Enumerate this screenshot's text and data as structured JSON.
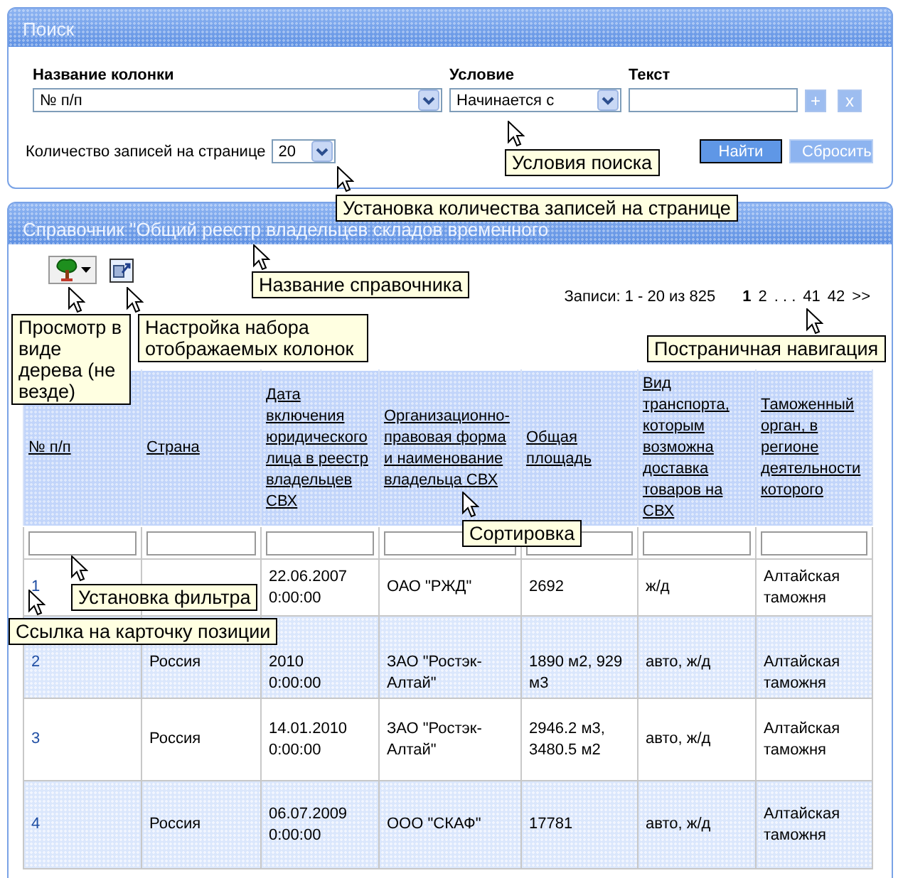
{
  "search": {
    "title": "Поиск",
    "column_label": "Название колонки",
    "column_value": "№ п/п",
    "condition_label": "Условие",
    "condition_value": "Начинается с",
    "text_label": "Текст",
    "add_button": "+",
    "remove_button": "x",
    "page_size_label": "Количество записей на странице",
    "page_size_value": "20",
    "find_button": "Найти",
    "reset_button": "Сбросить"
  },
  "directory": {
    "title": "Справочник \"Общий реестр владельцев складов временного",
    "records_info": "Записи: 1 - 20 из 825",
    "pagination": [
      {
        "label": "1",
        "selected": true
      },
      {
        "label": "2",
        "selected": false
      },
      {
        "label": ". . .",
        "selected": false
      },
      {
        "label": "41",
        "selected": false
      },
      {
        "label": "42",
        "selected": false
      },
      {
        "label": ">>",
        "selected": false
      }
    ],
    "table": {
      "columns": [
        "№ п/п",
        "Страна",
        "Дата включения юридического лица в реестр владельцев СВХ",
        "Организационно-правовая форма и наименование владельца СВХ",
        "Общая площадь",
        "Вид транспорта, которым возможна доставка товаров на СВХ",
        "Таможенный орган, в регионе деятельности которого"
      ],
      "rows": [
        {
          "number": "1",
          "date": "22.06.2007\n0:00:00",
          "owner": "ОАО \"РЖД\"",
          "area": "2692",
          "transport": "ж/д",
          "customs": "Алтайская таможня"
        },
        {
          "number": "2",
          "country": "Россия",
          "date": "2010\n0:00:00",
          "owner": "ЗАО \"Ростэк-Алтай\"",
          "area": "1890 м2, 929 м3",
          "transport": "авто, ж/д",
          "customs": "Алтайская таможня"
        },
        {
          "number": "3",
          "country": "Россия",
          "date": "14.01.2010\n0:00:00",
          "owner": "ЗАО \"Ростэк-Алтай\"",
          "area": "2946.2 м3, 3480.5 м2",
          "transport": "авто, ж/д",
          "customs": "Алтайская таможня"
        },
        {
          "number": "4",
          "country": "Россия",
          "date": "06.07.2009\n0:00:00",
          "owner": "ООО \"СКАФ\"",
          "area": "17781",
          "transport": "авто, ж/д",
          "customs": "Алтайская таможня"
        }
      ]
    }
  },
  "callouts": [
    {
      "text": "Условия поиска"
    },
    {
      "text": "Установка количества записей на странице"
    },
    {
      "text": "Название справочника"
    },
    {
      "text": "Просмотр в виде дерева (не везде)"
    },
    {
      "text": "Настройка набора отображаемых колонок"
    },
    {
      "text": "Постраничная навигация"
    },
    {
      "text": "Сортировка"
    },
    {
      "text": "Установка фильтра"
    },
    {
      "text": "Ссылка на карточку позиции"
    }
  ]
}
